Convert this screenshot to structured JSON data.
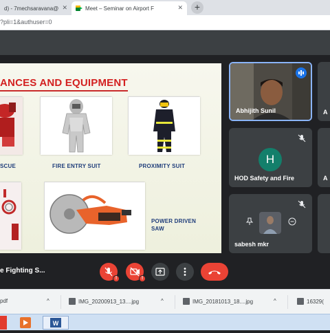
{
  "browser": {
    "tabs": [
      {
        "label": "d) - 7mechsaravana@",
        "close": "✕"
      },
      {
        "label": "Meet – Seminar on Airport F",
        "close": "✕"
      }
    ],
    "new_tab": "+",
    "url": "?pli=1&authuser=0"
  },
  "slide": {
    "title": "ANCES AND EQUIPMENT",
    "captions": {
      "rescue": "SCUE",
      "fire_entry": "FIRE ENTRY SUIT",
      "proximity": "PROXIMITY SUIT",
      "power_saw": "POWER DRIVEN SAW"
    }
  },
  "participants": [
    {
      "name": "Abhijith Sunil",
      "state": "speaking"
    },
    {
      "name": "HOD Safety and Fire",
      "initial": "H",
      "state": "muted"
    },
    {
      "name": "sabesh mkr",
      "state": "muted"
    }
  ],
  "participants_edge": [
    "A",
    "A"
  ],
  "meeting": {
    "caption": "e Fighting S..."
  },
  "controls": [
    {
      "name": "mic",
      "badge": "!"
    },
    {
      "name": "camera",
      "badge": "!"
    },
    {
      "name": "present"
    },
    {
      "name": "more"
    },
    {
      "name": "end-call"
    }
  ],
  "downloads": [
    {
      "name": "pdf",
      "chevron": "^"
    },
    {
      "name": "IMG_20200913_13....jpg",
      "chevron": "^"
    },
    {
      "name": "IMG_20181013_18....jpg",
      "chevron": "^"
    },
    {
      "name": "16329(",
      "chevron": ""
    }
  ],
  "colors": {
    "accent_red": "#ea4335",
    "meet_bg": "#202124",
    "tile_bg": "#3c4043",
    "title_red": "#d32020",
    "avatar_teal": "#137f6b",
    "speaking_blue": "#1a73e8"
  }
}
